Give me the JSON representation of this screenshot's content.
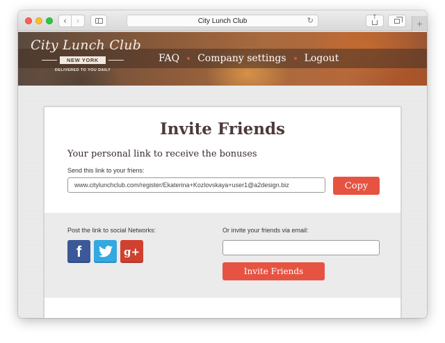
{
  "browser": {
    "tab_title": "City Lunch Club",
    "back_glyph": "‹",
    "forward_glyph": "›",
    "reload_glyph": "↻",
    "newtab_glyph": "+"
  },
  "header": {
    "logo": {
      "title": "City Lunch Club",
      "city": "NEW YORK",
      "tagline": "DELIVERED TO YOU DAILY"
    },
    "nav": [
      {
        "label": "FAQ"
      },
      {
        "label": "Company settings"
      },
      {
        "label": "Logout"
      }
    ]
  },
  "invite": {
    "title": "Invite Friends",
    "subtitle": "Your personal link to receive the bonuses",
    "send_label": "Send this link to your friens:",
    "link_value": "www.citylunchclub.com/register/Ekaterina+Kozlovskaya+user1@a2design.biz",
    "copy_label": "Copy",
    "social_label": "Post the link to social Networks:",
    "social": [
      {
        "name": "facebook",
        "glyph": "f",
        "color": "#3b5998"
      },
      {
        "name": "twitter",
        "glyph": "",
        "color": "#34a8e0"
      },
      {
        "name": "google-plus",
        "glyph": "g+",
        "color": "#d0402f"
      }
    ],
    "email_label": "Or invite your friends via email:",
    "email_value": "",
    "invite_label": "Invite Friends"
  },
  "colors": {
    "accent": "#e65342",
    "title_text": "#4d3a3a"
  }
}
